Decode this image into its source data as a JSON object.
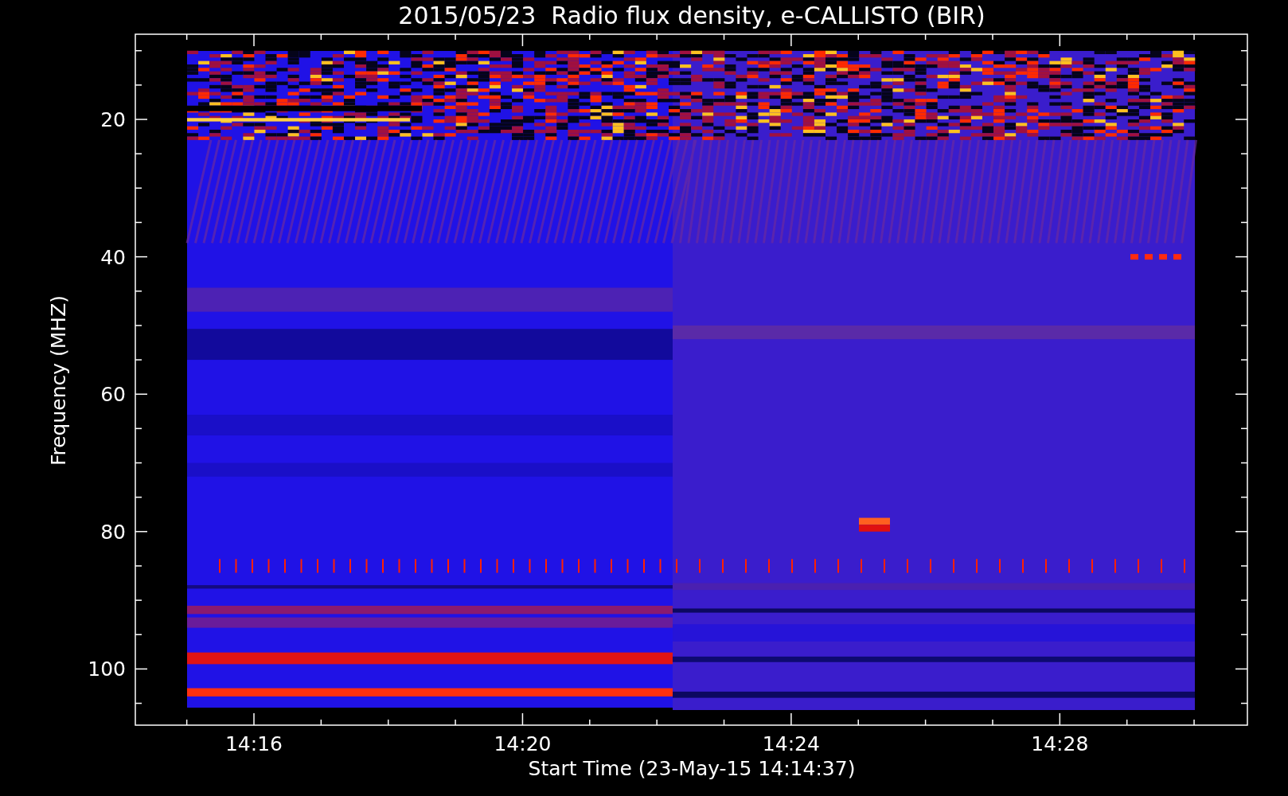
{
  "title": "2015/05/23  Radio flux density, e-CALLISTO (BIR)",
  "y_axis": {
    "label": "Frequency (MHZ)",
    "ticks": [
      "20",
      "40",
      "60",
      "80",
      "100"
    ]
  },
  "x_axis": {
    "label": "Start Time (23-May-15 14:14:37)",
    "ticks": [
      "14:16",
      "14:20",
      "14:24",
      "14:28"
    ]
  }
}
